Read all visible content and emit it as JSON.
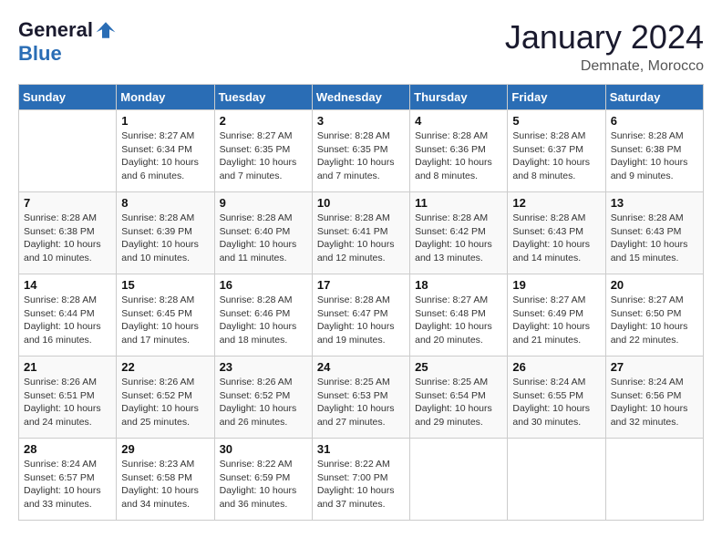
{
  "logo": {
    "general": "General",
    "blue": "Blue"
  },
  "title": "January 2024",
  "location": "Demnate, Morocco",
  "days_header": [
    "Sunday",
    "Monday",
    "Tuesday",
    "Wednesday",
    "Thursday",
    "Friday",
    "Saturday"
  ],
  "weeks": [
    [
      {
        "num": "",
        "sunrise": "",
        "sunset": "",
        "daylight": ""
      },
      {
        "num": "1",
        "sunrise": "Sunrise: 8:27 AM",
        "sunset": "Sunset: 6:34 PM",
        "daylight": "Daylight: 10 hours and 6 minutes."
      },
      {
        "num": "2",
        "sunrise": "Sunrise: 8:27 AM",
        "sunset": "Sunset: 6:35 PM",
        "daylight": "Daylight: 10 hours and 7 minutes."
      },
      {
        "num": "3",
        "sunrise": "Sunrise: 8:28 AM",
        "sunset": "Sunset: 6:35 PM",
        "daylight": "Daylight: 10 hours and 7 minutes."
      },
      {
        "num": "4",
        "sunrise": "Sunrise: 8:28 AM",
        "sunset": "Sunset: 6:36 PM",
        "daylight": "Daylight: 10 hours and 8 minutes."
      },
      {
        "num": "5",
        "sunrise": "Sunrise: 8:28 AM",
        "sunset": "Sunset: 6:37 PM",
        "daylight": "Daylight: 10 hours and 8 minutes."
      },
      {
        "num": "6",
        "sunrise": "Sunrise: 8:28 AM",
        "sunset": "Sunset: 6:38 PM",
        "daylight": "Daylight: 10 hours and 9 minutes."
      }
    ],
    [
      {
        "num": "7",
        "sunrise": "Sunrise: 8:28 AM",
        "sunset": "Sunset: 6:38 PM",
        "daylight": "Daylight: 10 hours and 10 minutes."
      },
      {
        "num": "8",
        "sunrise": "Sunrise: 8:28 AM",
        "sunset": "Sunset: 6:39 PM",
        "daylight": "Daylight: 10 hours and 10 minutes."
      },
      {
        "num": "9",
        "sunrise": "Sunrise: 8:28 AM",
        "sunset": "Sunset: 6:40 PM",
        "daylight": "Daylight: 10 hours and 11 minutes."
      },
      {
        "num": "10",
        "sunrise": "Sunrise: 8:28 AM",
        "sunset": "Sunset: 6:41 PM",
        "daylight": "Daylight: 10 hours and 12 minutes."
      },
      {
        "num": "11",
        "sunrise": "Sunrise: 8:28 AM",
        "sunset": "Sunset: 6:42 PM",
        "daylight": "Daylight: 10 hours and 13 minutes."
      },
      {
        "num": "12",
        "sunrise": "Sunrise: 8:28 AM",
        "sunset": "Sunset: 6:43 PM",
        "daylight": "Daylight: 10 hours and 14 minutes."
      },
      {
        "num": "13",
        "sunrise": "Sunrise: 8:28 AM",
        "sunset": "Sunset: 6:43 PM",
        "daylight": "Daylight: 10 hours and 15 minutes."
      }
    ],
    [
      {
        "num": "14",
        "sunrise": "Sunrise: 8:28 AM",
        "sunset": "Sunset: 6:44 PM",
        "daylight": "Daylight: 10 hours and 16 minutes."
      },
      {
        "num": "15",
        "sunrise": "Sunrise: 8:28 AM",
        "sunset": "Sunset: 6:45 PM",
        "daylight": "Daylight: 10 hours and 17 minutes."
      },
      {
        "num": "16",
        "sunrise": "Sunrise: 8:28 AM",
        "sunset": "Sunset: 6:46 PM",
        "daylight": "Daylight: 10 hours and 18 minutes."
      },
      {
        "num": "17",
        "sunrise": "Sunrise: 8:28 AM",
        "sunset": "Sunset: 6:47 PM",
        "daylight": "Daylight: 10 hours and 19 minutes."
      },
      {
        "num": "18",
        "sunrise": "Sunrise: 8:27 AM",
        "sunset": "Sunset: 6:48 PM",
        "daylight": "Daylight: 10 hours and 20 minutes."
      },
      {
        "num": "19",
        "sunrise": "Sunrise: 8:27 AM",
        "sunset": "Sunset: 6:49 PM",
        "daylight": "Daylight: 10 hours and 21 minutes."
      },
      {
        "num": "20",
        "sunrise": "Sunrise: 8:27 AM",
        "sunset": "Sunset: 6:50 PM",
        "daylight": "Daylight: 10 hours and 22 minutes."
      }
    ],
    [
      {
        "num": "21",
        "sunrise": "Sunrise: 8:26 AM",
        "sunset": "Sunset: 6:51 PM",
        "daylight": "Daylight: 10 hours and 24 minutes."
      },
      {
        "num": "22",
        "sunrise": "Sunrise: 8:26 AM",
        "sunset": "Sunset: 6:52 PM",
        "daylight": "Daylight: 10 hours and 25 minutes."
      },
      {
        "num": "23",
        "sunrise": "Sunrise: 8:26 AM",
        "sunset": "Sunset: 6:52 PM",
        "daylight": "Daylight: 10 hours and 26 minutes."
      },
      {
        "num": "24",
        "sunrise": "Sunrise: 8:25 AM",
        "sunset": "Sunset: 6:53 PM",
        "daylight": "Daylight: 10 hours and 27 minutes."
      },
      {
        "num": "25",
        "sunrise": "Sunrise: 8:25 AM",
        "sunset": "Sunset: 6:54 PM",
        "daylight": "Daylight: 10 hours and 29 minutes."
      },
      {
        "num": "26",
        "sunrise": "Sunrise: 8:24 AM",
        "sunset": "Sunset: 6:55 PM",
        "daylight": "Daylight: 10 hours and 30 minutes."
      },
      {
        "num": "27",
        "sunrise": "Sunrise: 8:24 AM",
        "sunset": "Sunset: 6:56 PM",
        "daylight": "Daylight: 10 hours and 32 minutes."
      }
    ],
    [
      {
        "num": "28",
        "sunrise": "Sunrise: 8:24 AM",
        "sunset": "Sunset: 6:57 PM",
        "daylight": "Daylight: 10 hours and 33 minutes."
      },
      {
        "num": "29",
        "sunrise": "Sunrise: 8:23 AM",
        "sunset": "Sunset: 6:58 PM",
        "daylight": "Daylight: 10 hours and 34 minutes."
      },
      {
        "num": "30",
        "sunrise": "Sunrise: 8:22 AM",
        "sunset": "Sunset: 6:59 PM",
        "daylight": "Daylight: 10 hours and 36 minutes."
      },
      {
        "num": "31",
        "sunrise": "Sunrise: 8:22 AM",
        "sunset": "Sunset: 7:00 PM",
        "daylight": "Daylight: 10 hours and 37 minutes."
      },
      {
        "num": "",
        "sunrise": "",
        "sunset": "",
        "daylight": ""
      },
      {
        "num": "",
        "sunrise": "",
        "sunset": "",
        "daylight": ""
      },
      {
        "num": "",
        "sunrise": "",
        "sunset": "",
        "daylight": ""
      }
    ]
  ]
}
